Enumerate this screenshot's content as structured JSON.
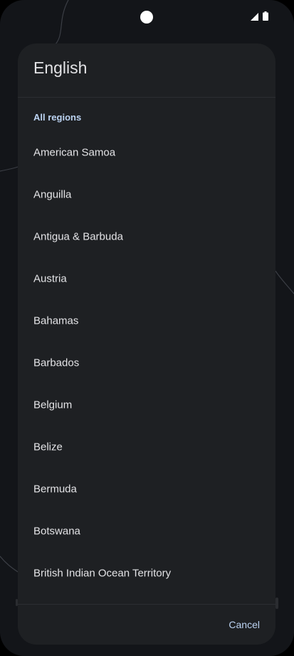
{
  "dialog": {
    "title": "English",
    "section_header": "All regions",
    "regions": [
      "American Samoa",
      "Anguilla",
      "Antigua & Barbuda",
      "Austria",
      "Bahamas",
      "Barbados",
      "Belgium",
      "Belize",
      "Bermuda",
      "Botswana",
      "British Indian Ocean Territory"
    ],
    "cancel_label": "Cancel"
  },
  "status_bar": {
    "icons": [
      "camera-cutout",
      "signal-icon",
      "battery-icon"
    ]
  },
  "colors": {
    "background": "#131519",
    "dialog_surface": "#1e2023",
    "primary_text": "#e3e3e6",
    "accent": "#bcd3f2"
  }
}
